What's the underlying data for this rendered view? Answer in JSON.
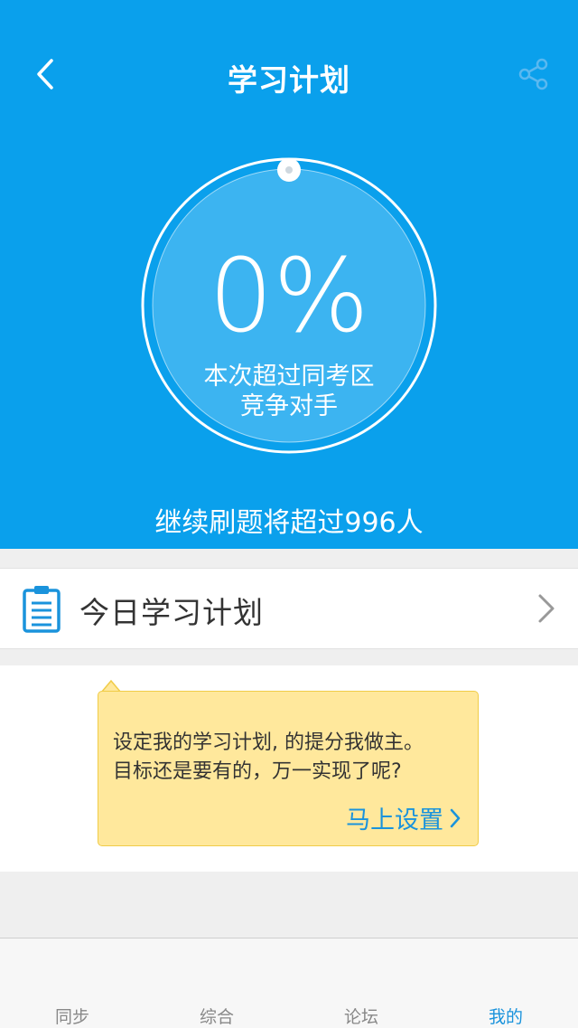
{
  "header": {
    "title": "学习计划",
    "back_icon": "chevron-left-icon",
    "share_icon": "share-icon"
  },
  "progress": {
    "percent_text": "0%",
    "percent_value": 0,
    "caption_line1": "本次超过同考区",
    "caption_line2": "竞争对手",
    "footer_note": "继续刷题将超过996人"
  },
  "plan_row": {
    "label": "今日学习计划",
    "icon": "clipboard-icon",
    "arrow_icon": "chevron-right-icon"
  },
  "tip": {
    "line1": "设定我的学习计划, 的提分我做主。",
    "line2": "目标还是要有的，万一实现了呢?",
    "action_label": "马上设置"
  },
  "tabs": [
    {
      "label": "同步",
      "active": false
    },
    {
      "label": "综合",
      "active": false
    },
    {
      "label": "论坛",
      "active": false
    },
    {
      "label": "我的",
      "active": true
    }
  ],
  "colors": {
    "primary": "#0aa0ec",
    "accent": "#1a93dc",
    "tip_background": "#ffe89c"
  }
}
